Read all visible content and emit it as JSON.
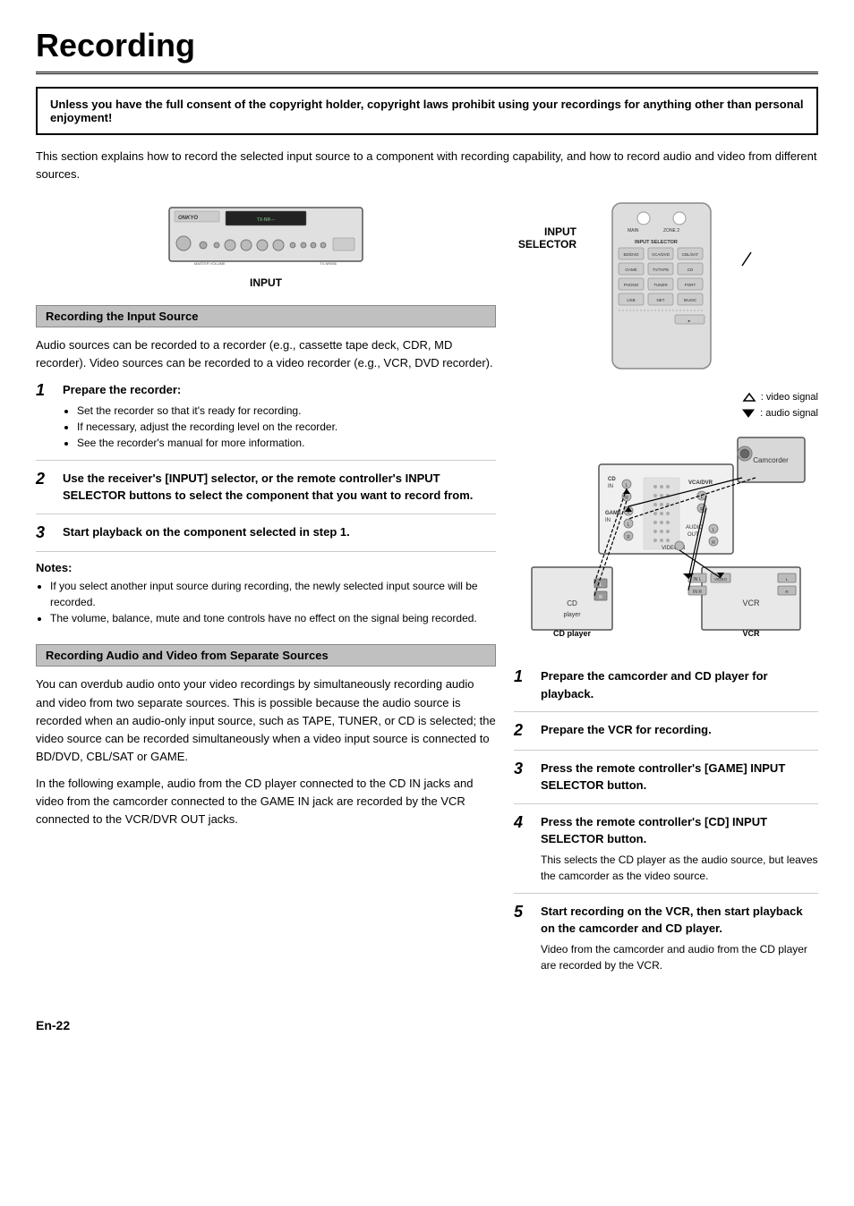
{
  "page": {
    "title": "Recording",
    "footer": "En-22"
  },
  "warning": {
    "text": "Unless you have the full consent of the copyright holder, copyright laws prohibit using your recordings for anything other than personal enjoyment!"
  },
  "intro": "This section explains how to record the selected input source to a component with recording capability, and how to record audio and video from different sources.",
  "input_label": "INPUT",
  "input_selector_label": "INPUT\nSELECTOR",
  "signal_legend": {
    "video": ": video signal",
    "audio": ": audio signal"
  },
  "section1": {
    "title": "Recording the Input Source",
    "body": "Audio sources can be recorded to a recorder (e.g., cassette tape deck, CDR, MD recorder). Video sources can be recorded to a video recorder (e.g., VCR, DVD recorder).",
    "steps": [
      {
        "num": "1",
        "bold": "Prepare the recorder:",
        "bullets": [
          "Set the recorder so that it's ready for recording.",
          "If necessary, adjust the recording level on the recorder.",
          "See the recorder's manual for more information."
        ]
      },
      {
        "num": "2",
        "bold": "Use the receiver's [INPUT] selector, or the remote controller's INPUT SELECTOR buttons to select the component that you want to record from.",
        "bullets": []
      },
      {
        "num": "3",
        "bold": "Start playback on the component selected in step 1.",
        "bullets": []
      }
    ],
    "notes_title": "Notes:",
    "notes": [
      "If you select another input source during recording, the newly selected input source will be recorded.",
      "The volume, balance, mute and tone controls have no effect on the signal being recorded."
    ]
  },
  "section2": {
    "title": "Recording Audio and Video from Separate Sources",
    "body1": "You can overdub audio onto your video recordings by simultaneously recording audio and video from two separate sources. This is possible because the audio source is recorded when an audio-only input source, such as TAPE, TUNER, or CD is selected; the video source can be recorded simultaneously when a video input source is connected to BD/DVD, CBL/SAT or GAME.",
    "body2": "In the following example, audio from the CD player connected to the CD IN jacks and video from the camcorder connected to the GAME IN jack are recorded by the VCR connected to the VCR/DVR OUT jacks.",
    "cd_label": "CD player",
    "vcr_label": "VCR",
    "steps": [
      {
        "num": "1",
        "bold": "Prepare the camcorder and CD player for playback.",
        "text": ""
      },
      {
        "num": "2",
        "bold": "Prepare the VCR for recording.",
        "text": ""
      },
      {
        "num": "3",
        "bold": "Press the remote controller's [GAME] INPUT SELECTOR button.",
        "text": ""
      },
      {
        "num": "4",
        "bold": "Press the remote controller's [CD] INPUT SELECTOR button.",
        "text": "This selects the CD player as the audio source, but leaves the camcorder as the video source."
      },
      {
        "num": "5",
        "bold": "Start recording on the VCR, then start playback on the camcorder and CD player.",
        "text": "Video from the camcorder and audio from the CD player are recorded by the VCR."
      }
    ]
  }
}
